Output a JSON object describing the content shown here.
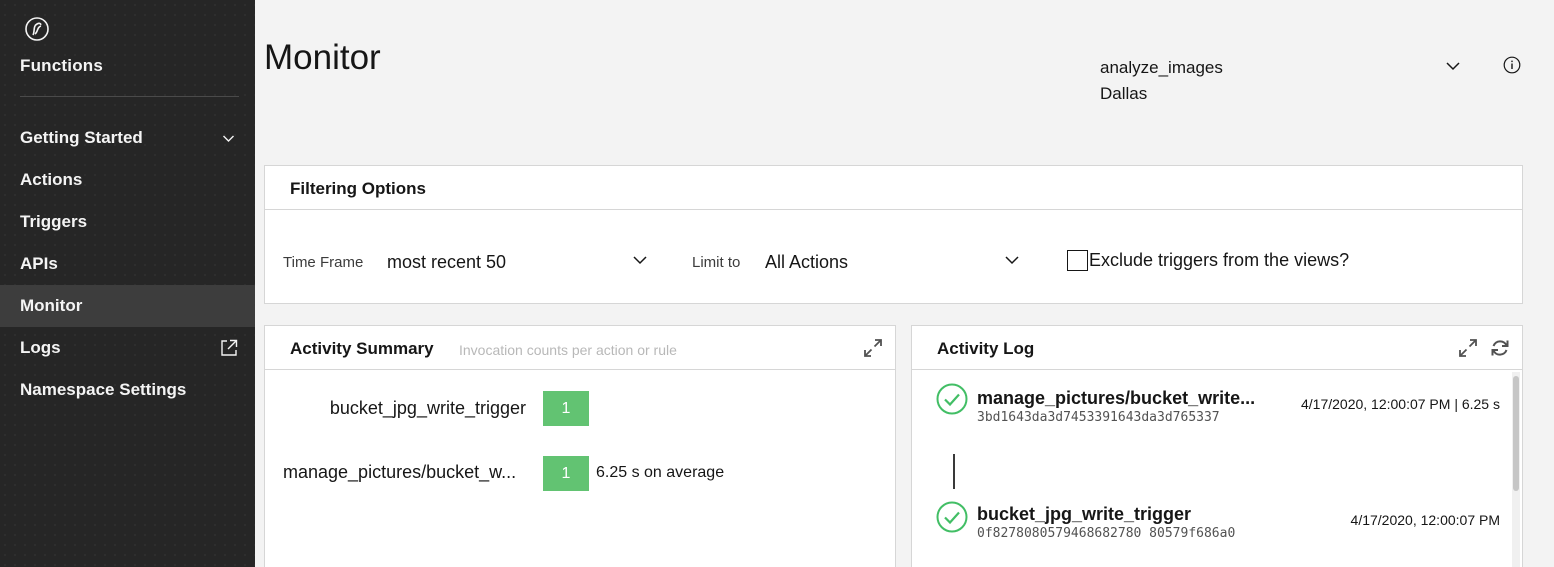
{
  "sidebar": {
    "brand": "Functions",
    "items": [
      {
        "label": "Getting Started",
        "has_chevron": true
      },
      {
        "label": "Actions"
      },
      {
        "label": "Triggers"
      },
      {
        "label": "APIs"
      },
      {
        "label": "Monitor",
        "active": true
      },
      {
        "label": "Logs",
        "external": true
      },
      {
        "label": "Namespace Settings"
      }
    ]
  },
  "header": {
    "title": "Monitor",
    "namespace": "analyze_images",
    "region": "Dallas"
  },
  "filtering": {
    "title": "Filtering Options",
    "time_frame_label": "Time Frame",
    "time_frame_value": "most recent 50",
    "limit_label": "Limit to",
    "limit_value": "All Actions",
    "exclude_label": "Exclude triggers from the views?",
    "exclude_checked": false
  },
  "summary": {
    "title": "Activity Summary",
    "subtitle": "Invocation counts per action or rule",
    "rows": [
      {
        "name": "bucket_jpg_write_trigger",
        "count": "1",
        "avg": ""
      },
      {
        "name": "manage_pictures/bucket_w...",
        "count": "1",
        "avg": "6.25 s on average"
      }
    ]
  },
  "log": {
    "title": "Activity Log",
    "entries": [
      {
        "name": "manage_pictures/bucket_write...",
        "id": "3bd1643da3d7453391643da3d765337",
        "time": "4/17/2020, 12:00:07 PM |  6.25 s",
        "status": "success"
      },
      {
        "name": "bucket_jpg_write_trigger",
        "id": "0f8278080579468682780 80579f686a0",
        "time": "4/17/2020, 12:00:07 PM",
        "status": "success"
      }
    ]
  },
  "colors": {
    "sidebar_bg": "#262626",
    "success": "#62c372",
    "check_green": "#42be65"
  }
}
